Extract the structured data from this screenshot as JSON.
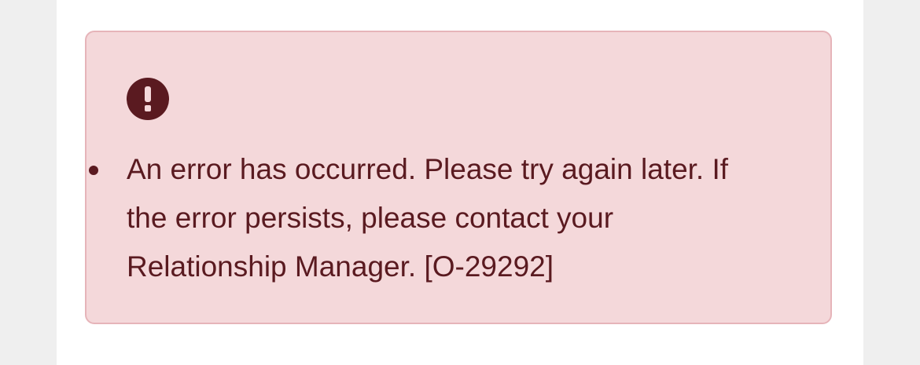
{
  "alert": {
    "type": "error",
    "icon": "exclamation-circle-icon",
    "colors": {
      "background": "#f4d8da",
      "border": "#e6b4b9",
      "text": "#5a1a20"
    },
    "messages": [
      "An error has occurred. Please try again later. If the error persists, please contact your Relationship Manager. [O-29292]"
    ]
  }
}
